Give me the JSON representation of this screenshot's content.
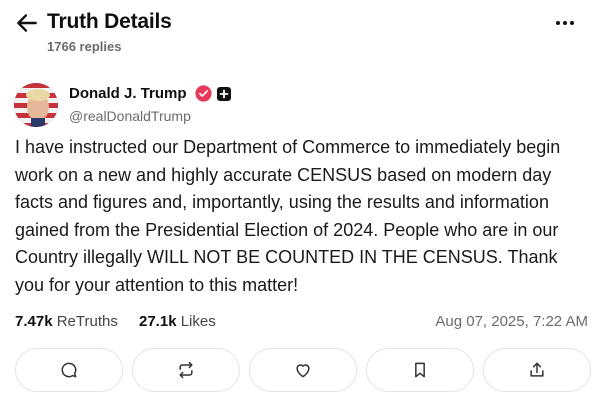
{
  "header": {
    "title": "Truth Details",
    "reply_count": "1766 replies"
  },
  "post": {
    "author_name": "Donald J. Trump",
    "handle": "@realDonaldTrump",
    "text": "I have instructed our Department of Commerce to immediately begin work on a new and highly accurate CENSUS based on modern day facts and figures and, importantly, using the results and information gained from the Presidential Election of 2024. People who are in our Country illegally WILL NOT BE COUNTED IN THE CENSUS. Thank you for your attention to this matter!",
    "retruths_count": "7.47k",
    "retruths_label": "ReTruths",
    "likes_count": "27.1k",
    "likes_label": "Likes",
    "timestamp": "Aug 07, 2025, 7:22 AM"
  },
  "colors": {
    "verified_badge": "#e8385b",
    "muted_text": "#6b6b6b",
    "border": "#e3e3e3"
  },
  "icons": [
    "back-arrow-icon",
    "more-icon",
    "verified-icon",
    "plus-icon",
    "reply-icon",
    "retruth-icon",
    "like-icon",
    "bookmark-icon",
    "share-icon"
  ]
}
